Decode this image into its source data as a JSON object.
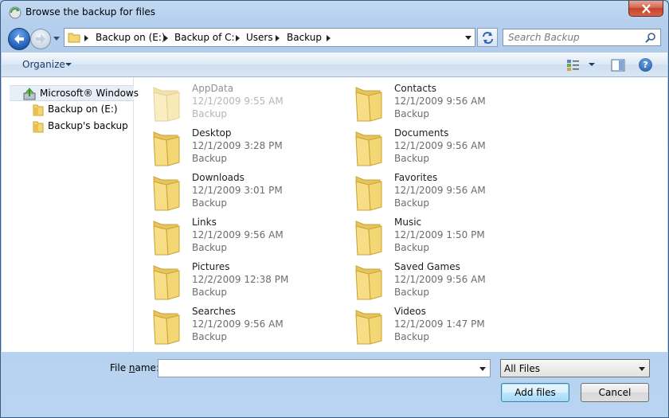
{
  "window": {
    "title": "Browse the backup for files"
  },
  "navigation": {
    "breadcrumbs": [
      "Backup on (E:)",
      "Backup of C:",
      "Users",
      "Backup"
    ],
    "search_placeholder": "Search Backup"
  },
  "toolbar": {
    "organize_label": "Organize",
    "icons": [
      "views-icon",
      "preview-pane-icon",
      "help-icon"
    ]
  },
  "nav_pane": {
    "root_label": "Microsoft® Windows",
    "items": [
      {
        "label": "Backup on (E:)"
      },
      {
        "label": "Backup's backup"
      }
    ]
  },
  "files": [
    {
      "name": "AppData",
      "date": "12/1/2009 9:55 AM",
      "location": "Backup",
      "hidden": true
    },
    {
      "name": "Contacts",
      "date": "12/1/2009 9:56 AM",
      "location": "Backup"
    },
    {
      "name": "Desktop",
      "date": "12/1/2009 3:28 PM",
      "location": "Backup"
    },
    {
      "name": "Documents",
      "date": "12/1/2009 9:56 AM",
      "location": "Backup"
    },
    {
      "name": "Downloads",
      "date": "12/1/2009 3:01 PM",
      "location": "Backup"
    },
    {
      "name": "Favorites",
      "date": "12/1/2009 9:56 AM",
      "location": "Backup"
    },
    {
      "name": "Links",
      "date": "12/1/2009 9:56 AM",
      "location": "Backup"
    },
    {
      "name": "Music",
      "date": "12/1/2009 1:50 PM",
      "location": "Backup"
    },
    {
      "name": "Pictures",
      "date": "12/2/2009 12:38 PM",
      "location": "Backup"
    },
    {
      "name": "Saved Games",
      "date": "12/1/2009 9:56 AM",
      "location": "Backup"
    },
    {
      "name": "Searches",
      "date": "12/1/2009 9:56 AM",
      "location": "Backup"
    },
    {
      "name": "Videos",
      "date": "12/1/2009 1:47 PM",
      "location": "Backup"
    }
  ],
  "footer": {
    "filename_label_pre": "File ",
    "filename_label_accel": "n",
    "filename_label_post": "ame:",
    "filename_value": "",
    "filter_value": "All Files",
    "add_files_label": "Add files",
    "cancel_label": "Cancel"
  },
  "colors": {
    "folder": "#f3d774",
    "accent": "#1f5fb8",
    "close_button": "#c4432a"
  }
}
